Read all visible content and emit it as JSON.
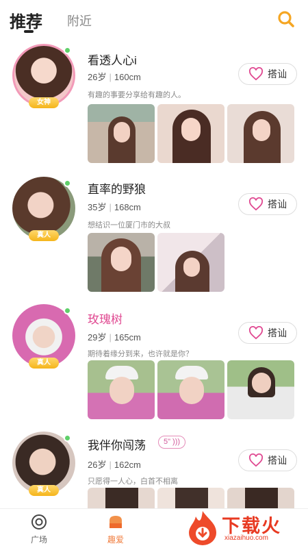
{
  "header": {
    "tab_recommended": "推荐",
    "tab_nearby": "附近"
  },
  "cards": [
    {
      "name": "看透人心i",
      "age": "26岁",
      "height": "160cm",
      "bio": "有趣的事要分享给有趣的人。",
      "badge": "女神",
      "chat_label": "搭讪",
      "photos": 3
    },
    {
      "name": "直率的野狼",
      "age": "35岁",
      "height": "168cm",
      "bio": "想结识一位厦门市的大叔",
      "badge": "真人",
      "chat_label": "搭讪",
      "photos": 2
    },
    {
      "name": "玫瑰树",
      "age": "29岁",
      "height": "165cm",
      "bio": "期待着缘分到来，也许就是你？",
      "badge": "真人",
      "chat_label": "搭讪",
      "photos": 3
    },
    {
      "name": "我伴你闯荡",
      "voice_duration": "5\"",
      "age": "26岁",
      "height": "162cm",
      "bio": "只愿得一人心，白首不相离",
      "badge": "真人",
      "chat_label": "搭讪",
      "photos": 3
    }
  ],
  "navbar": {
    "plaza_label": "广场",
    "interest_label": "趣爱"
  },
  "watermark": {
    "title": "下载火",
    "url": "xiazaihuo.com"
  },
  "colors": {
    "accent_pink": "#e04a92",
    "badge_gold": "#f5b51c",
    "active_orange": "#f07b3b",
    "online_green": "#5fd06a"
  }
}
